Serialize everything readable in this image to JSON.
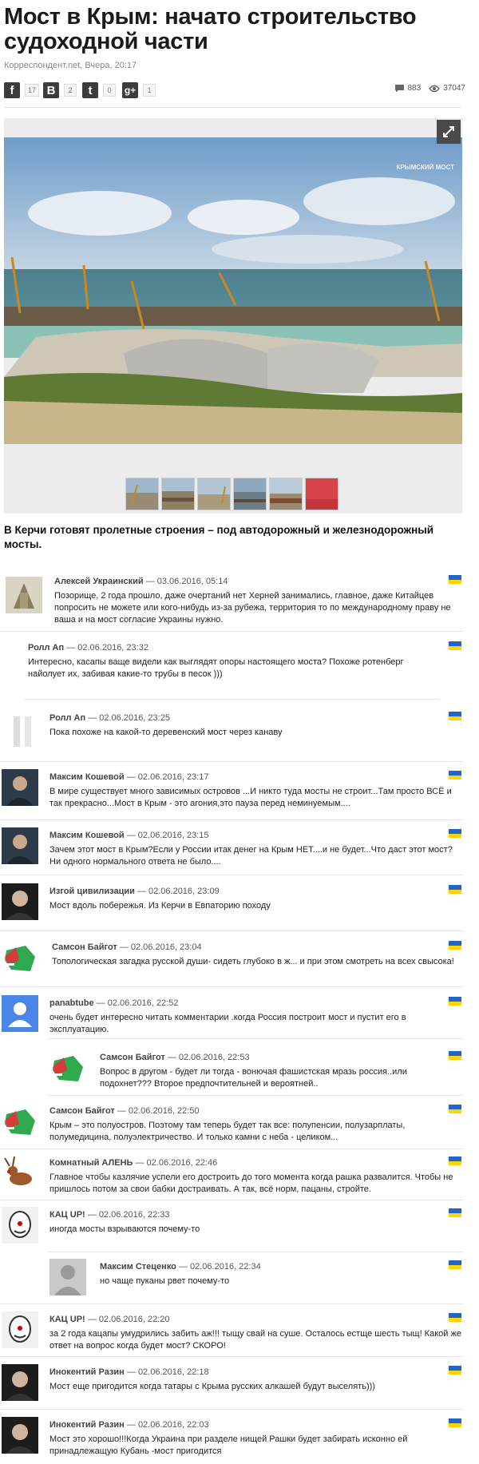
{
  "article": {
    "title": "Мост в Крым: начато строительство судоходной части",
    "meta": "Корреспондент.net, Вчера, 20:17",
    "lead": "В Керчи готовят пролетные строения – под автодорожный и железнодорожный мосты.",
    "watermark": "КРЫМСКИЙ МОСТ"
  },
  "shares": [
    {
      "icon": "facebook-icon",
      "glyph": "f",
      "count": "17"
    },
    {
      "icon": "vkontakte-icon",
      "glyph": "В",
      "count": "2"
    },
    {
      "icon": "twitter-icon",
      "glyph": "t",
      "count": "0"
    },
    {
      "icon": "googleplus-icon",
      "glyph": "g+",
      "count": "1"
    }
  ],
  "stats": {
    "comments": "883",
    "views": "37047"
  },
  "colors": {
    "flag_blue": "#1f66c8",
    "flag_yellow": "#ffd400",
    "share_bg": "#3c3c3c"
  },
  "comments": [
    {
      "author": "Алексей Украинский",
      "date": " — 03.06.2016, 05:14",
      "text": "Позорище, 2 года прошло, даже очертаний нет Херней занимались, главное, даже Китайцев попросить не можете или кого-нибудь из-за рубежа, территория то по международному праву не ваша и на мост согласие Украины нужно."
    },
    {
      "author": "Ролл Ап",
      "date": " — 02.06.2016, 23:32",
      "text": "Интересно, касапы ваще видели как выглядят опоры настоящего моста? Похоже ротенберг найолует их, забивая какие-то трубы в песок )))"
    },
    {
      "author": "Ролл Ап",
      "date": " — 02.06.2016, 23:25",
      "text": "Пока похоже на какой-то деревенский мост через канаву"
    },
    {
      "author": "Максим Кошевой",
      "date": " — 02.06.2016, 23:17",
      "text": "В мире существует много зависимых островов ...И никто туда мосты не строит...Там просто ВСЁ и так прекрасно...Мост в Крым - это агония,это пауза перед неминуемым...."
    },
    {
      "author": "Максим Кошевой",
      "date": " — 02.06.2016, 23:15",
      "text": "Зачем этот мост в Крым?Если у России итак денег на Крым НЕТ....и не будет...Что даст этот мост? Ни одного нормального ответа не было...."
    },
    {
      "author": "Изгой цивилизации",
      "date": " — 02.06.2016, 23:09",
      "text": "Мост вдоль побережья. Из Керчи в Евпаторию походу"
    },
    {
      "author": "Самсон Байгот",
      "date": " — 02.06.2016, 23:04",
      "text": "Топологическая загадка русской души- сидеть глубоко в ж... и при этом смотреть на всех свысока!"
    },
    {
      "author": "panabtube",
      "date": " — 02.06.2016, 22:52",
      "text": "очень будет интересно читать комментарии .когда Россия построит мост и пустит его в эксплуатацию."
    },
    {
      "author": "Самсон Байгот",
      "date": " — 02.06.2016, 22:53",
      "text": "Вопрос в другом - будет ли тогда - вонючая фашистская мразь россия..или подохнет??? Второе предпочтительней и вероятней.."
    },
    {
      "author": "Самсон Байгот",
      "date": " — 02.06.2016, 22:50",
      "text": "Крым – это полуостров. Поэтому там теперь будет так все: полупенсии, полузарплаты, полумедицина, полуэлектричество. И только камни с неба - целиком..."
    },
    {
      "author": "Комнатный АЛЕНЬ",
      "date": " — 02.06.2016, 22:46",
      "text": "Главное чтобы казлячие успели его достроить до того момента когда рашка развалится. Чтобы не пришлось потом за свои бабки достраивать. А так, всё норм, пацаны, стройте."
    },
    {
      "author": "КАЦ UP!",
      "date": " — 02.06.2016, 22:33",
      "text": "иногда мосты взрываются почему-то"
    },
    {
      "author": "Максим Стеценко",
      "date": " — 02.06.2016, 22:34",
      "text": "но чаще пуканы рвет почему-то"
    },
    {
      "author": "КАЦ UP!",
      "date": " — 02.06.2016, 22:20",
      "text": "за 2 года кацапы умудрились забить аж!!! тыщу свай на суше. Осталось естще шесть тыщ! Какой же ответ на вопрос когда будет мост? СКОРО!"
    },
    {
      "author": "Инокентий Разин",
      "date": " — 02.06.2016, 22:18",
      "text": "Мост еще пригодится когда татары с Крыма русских алкашей будут выселять)))"
    },
    {
      "author": "Инокентий Разин",
      "date": " — 02.06.2016, 22:03",
      "text": "Мост это хорошо!!!Когда Украина при разделе нищей Рашки будет забирать исконно ей принадлежащую Кубань -мост пригодится"
    }
  ]
}
